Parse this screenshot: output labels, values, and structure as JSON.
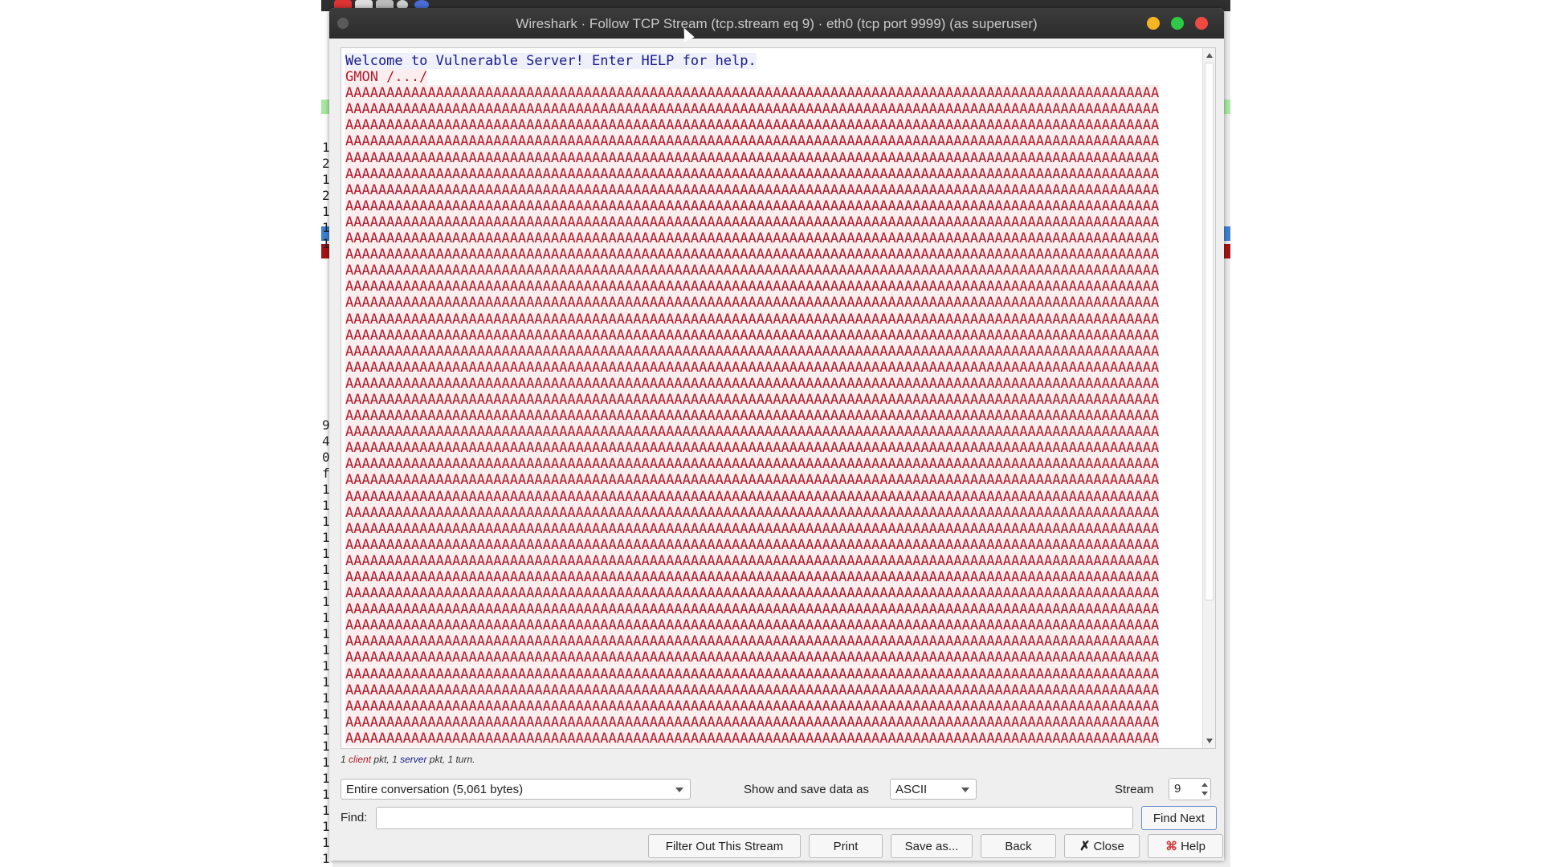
{
  "dialog": {
    "title": "Wireshark · Follow TCP Stream (tcp.stream eq 9) · eth0 (tcp port 9999) (as superuser)"
  },
  "stream": {
    "server_line": "Welcome to Vulnerable Server! Enter HELP for help.",
    "client_line": "GMON /.../",
    "payload_line": "AAAAAAAAAAAAAAAAAAAAAAAAAAAAAAAAAAAAAAAAAAAAAAAAAAAAAAAAAAAAAAAAAAAAAAAAAAAAAAAAAAAAAAAAAAAAAAAAAAA",
    "payload_row_count": 41
  },
  "status": {
    "count_client": "1",
    "client_word": "client",
    "mid": "pkt, 1",
    "server_word": "server",
    "tail": "pkt, 1 turn."
  },
  "controls": {
    "conversation": "Entire conversation (5,061 bytes)",
    "show_label": "Show and save data as",
    "format": "ASCII",
    "stream_label": "Stream",
    "stream_value": "9",
    "find_label": "Find:",
    "find_value": "",
    "find_next": "Find Next"
  },
  "buttons": {
    "filter_out": "Filter Out This Stream",
    "print": "Print",
    "save_as": "Save as...",
    "back": "Back",
    "close": "Close",
    "help": "Help"
  },
  "background": {
    "row_numbers_top": [
      "1",
      "2",
      "1",
      "2",
      "1",
      "1",
      "1"
    ],
    "row_numbers_bottom": [
      "9",
      "4",
      "0",
      "f",
      "1",
      "1",
      "1",
      "1",
      "1",
      "1",
      "1",
      "1",
      "1",
      "1",
      "1",
      "1",
      "1",
      "1",
      "1",
      "1",
      "1",
      "1",
      "1",
      "1",
      "1",
      "1",
      "1",
      "1"
    ]
  },
  "colors": {
    "server_text": "#1a1a8c",
    "client_text": "#b01c2e",
    "selected_row": "#3f7fcf",
    "error_row": "#a31414"
  }
}
